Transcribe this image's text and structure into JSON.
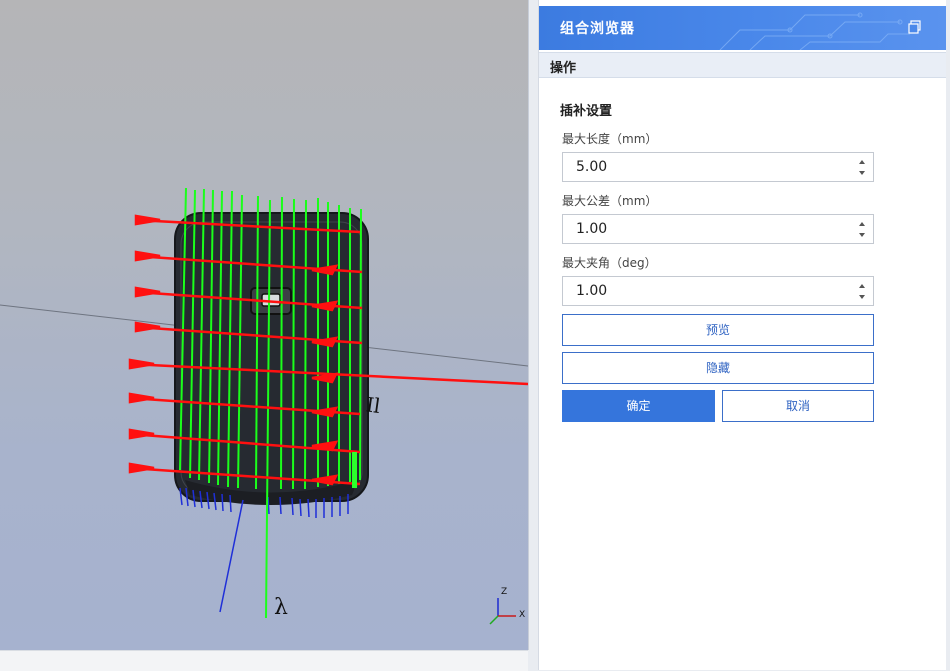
{
  "panel": {
    "title": "组合浏览器",
    "section": "操作",
    "group_title": "插补设置",
    "fields": [
      {
        "label": "最大长度（mm）",
        "value": "5.00"
      },
      {
        "label": "最大公差（mm）",
        "value": "1.00"
      },
      {
        "label": "最大夹角（deg）",
        "value": "1.00"
      }
    ],
    "buttons": {
      "preview": "预览",
      "hide": "隐藏",
      "confirm": "确定",
      "cancel": "取消"
    }
  },
  "viewport": {
    "axis_labels": {
      "z": "Z",
      "x": "X"
    },
    "colors": {
      "guide": "#ff0000",
      "wire": "#00ff00",
      "normal": "#0000ff",
      "body": "#2a2c33"
    }
  },
  "colors": {
    "accent": "#3575dc",
    "header": "#4a88ea"
  }
}
